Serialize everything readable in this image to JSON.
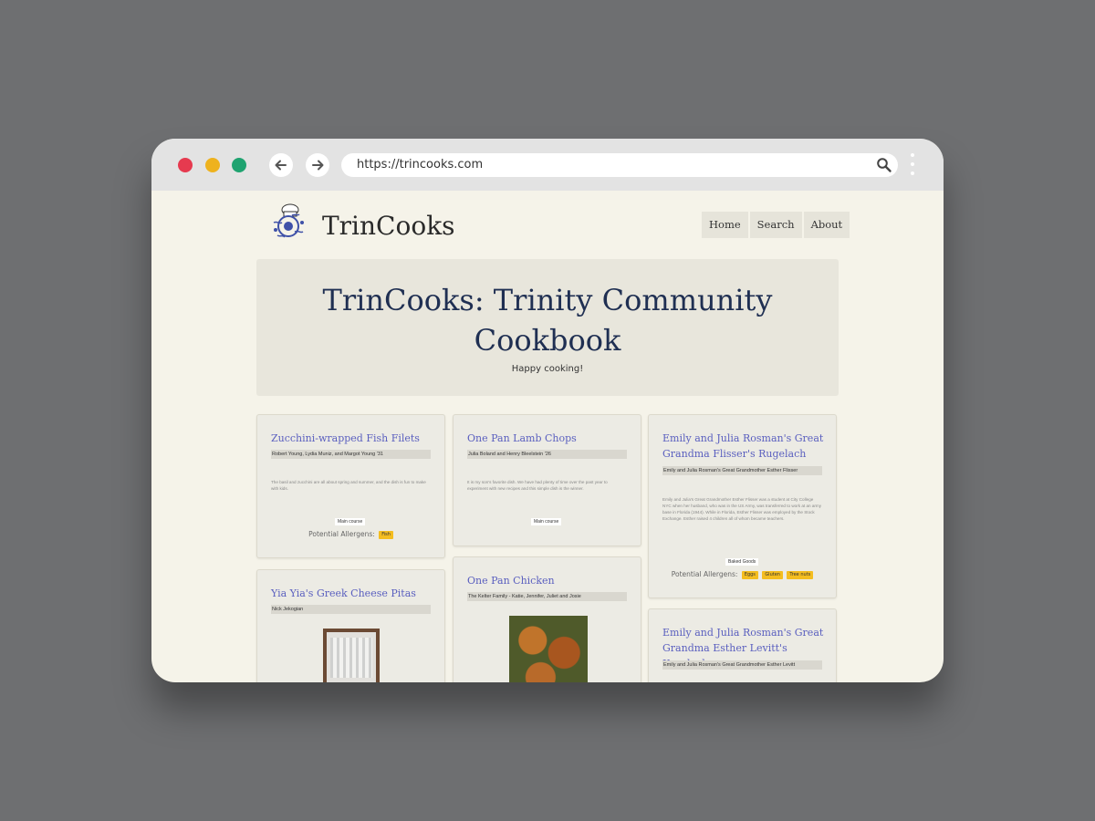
{
  "browser": {
    "url": "https://trincooks.com"
  },
  "site": {
    "brand": "TrinCooks",
    "nav": [
      "Home",
      "Search",
      "About"
    ]
  },
  "hero": {
    "title_line1": "TrinCooks: Trinity Community",
    "title_line2": "Cookbook",
    "subtitle": "Happy cooking!"
  },
  "recipes": [
    {
      "title": "Zucchini-wrapped Fish Filets",
      "authors": "Robert Young, Lydia Muniz, and Margot Young '31",
      "description": "The basil and zucchini are all about spring and summer, and the dish is fun to make with kids.",
      "course": "Main course",
      "allergens_label": "Potential Allergens:",
      "allergens": [
        "Fish"
      ]
    },
    {
      "title": "One Pan Lamb Chops",
      "authors": "Julia Boland and Henry Bleelstein '26",
      "description": "It is my son's favorite dish. We have had plenty of time over the past year to experiment with new recipes and this simple dish is the winner.",
      "course": "Main course"
    },
    {
      "title": "Emily and Julia Rosman's Great Grandma Flisser's Rugelach",
      "authors": "Emily and Julia Rosman's Great Grandmother Esther Flisser",
      "description": "Emily and Julia's Great Grandmother Esther Flisser was a student at City College NYC when her husband, who was in the US Army, was transferred to work at an army base in Florida (1944). While in Florida, Esther Flisser was employed by the Stock Exchange. Esther raised 4 children all of whom became teachers.",
      "course": "Baked Goods",
      "allergens_label": "Potential Allergens:",
      "allergens": [
        "Eggs",
        "Gluten",
        "Tree nuts"
      ]
    },
    {
      "title": "Yia Yia's Greek Cheese Pitas",
      "authors": "Nick Jekogian"
    },
    {
      "title": "One Pan Chicken",
      "authors": "The Kelter Family - Katie, Jennifer, Juliet and Josie"
    },
    {
      "title": "Emily and Julia Rosman's Great Grandma Esther Levitt's Kreplach",
      "authors": "Emily and Julia Rosman's Great Grandmother Esther Levitt"
    }
  ],
  "icons": {
    "back": "arrow-left-icon",
    "forward": "arrow-right-icon",
    "search": "search-icon",
    "menu": "kebab-menu-icon",
    "logo": "chef-logo-icon"
  },
  "colors": {
    "page_bg": "#f5f3e9",
    "hero_title": "#1f2f52",
    "card_title": "#5a5fbf",
    "allergen_badge": "#f4bd1f"
  }
}
